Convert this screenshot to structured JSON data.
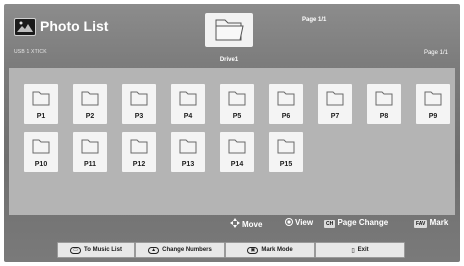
{
  "header": {
    "title": "Photo List",
    "device_label": "USB 1 XTICK",
    "drive_label": "Drive1",
    "page_top": "Page 1/1",
    "page_right": "Page 1/1"
  },
  "folders": [
    {
      "label": "P1"
    },
    {
      "label": "P2"
    },
    {
      "label": "P3"
    },
    {
      "label": "P4"
    },
    {
      "label": "P5"
    },
    {
      "label": "P6"
    },
    {
      "label": "P7"
    },
    {
      "label": "P8"
    },
    {
      "label": "P9"
    },
    {
      "label": "P10"
    },
    {
      "label": "P11"
    },
    {
      "label": "P12"
    },
    {
      "label": "P13"
    },
    {
      "label": "P14"
    },
    {
      "label": "P15"
    }
  ],
  "hints": {
    "move": "Move",
    "view": "View",
    "page_change": "Page Change",
    "mark": "Mark",
    "page_key": "CH",
    "mark_key": "FAV"
  },
  "buttons": {
    "music_list": "To Music List",
    "change_numbers": "Change Numbers",
    "mark_mode": "Mark Mode",
    "exit": "Exit"
  }
}
